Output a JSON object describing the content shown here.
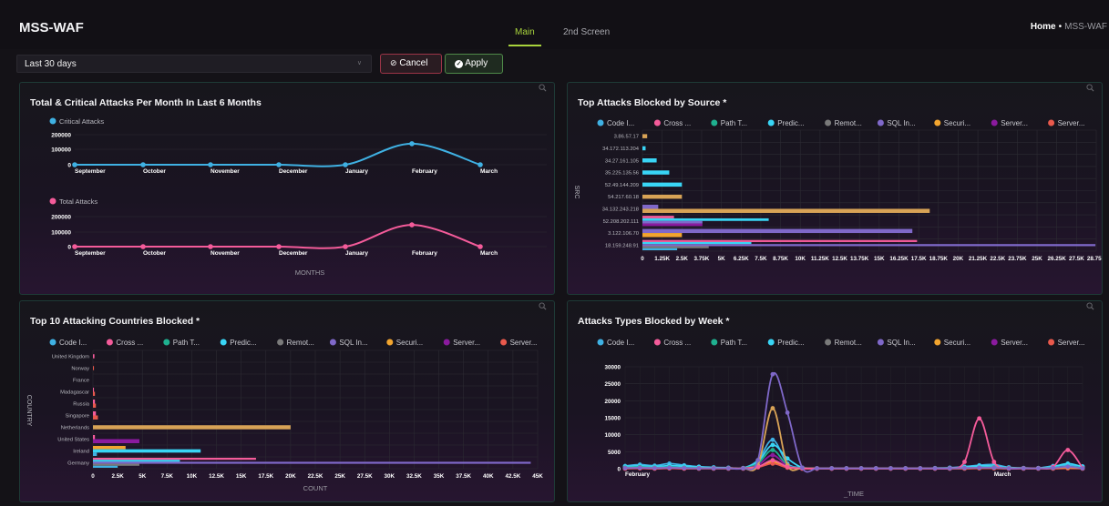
{
  "app": {
    "title": "MSS-WAF"
  },
  "tabs": [
    {
      "label": "Main",
      "active": true
    },
    {
      "label": "2nd Screen",
      "active": false
    }
  ],
  "breadcrumb": {
    "home": "Home",
    "separator": "•",
    "current": "MSS-WAF"
  },
  "filter": {
    "range_value": "Last 30 days",
    "cancel_label": "Cancel",
    "apply_label": "Apply"
  },
  "colors": {
    "accent": "#a8d33c",
    "series": {
      "Code I...": "#3fb1e3",
      "Cross ...": "#f45b9a",
      "Path T...": "#1fb08f",
      "Predic...": "#39d5f5",
      "Remot...": "#7a7a7a",
      "SQL In...": "#7f68c9",
      "Securi...": "#f2a52f",
      "Server...": "#8a1a9e",
      "Server... ": "#e9594c",
      "URL A...": "#d8a356"
    }
  },
  "chart_data": [
    {
      "type": "line",
      "title": "Total & Critical Attacks Per Month In Last 6 Months",
      "xlabel": "MONTHS",
      "categories": [
        "September",
        "October",
        "November",
        "December",
        "January",
        "February",
        "March"
      ],
      "ylim": [
        0,
        200000
      ],
      "yticks": [
        "200000",
        "100000",
        "0"
      ],
      "series": [
        {
          "name": "Critical Attacks",
          "color": "#3fb1e3",
          "values": [
            0,
            0,
            0,
            0,
            0,
            140000,
            0
          ]
        },
        {
          "name": "Total Attacks",
          "color": "#f45b9a",
          "values": [
            0,
            0,
            0,
            0,
            0,
            145000,
            0
          ]
        }
      ]
    },
    {
      "type": "bar",
      "orientation": "horizontal",
      "stacked": true,
      "title": "Top Attacks Blocked by Source *",
      "ylabel": "SRC",
      "xlim": [
        0,
        28750
      ],
      "xticks": [
        "0",
        "1.25K",
        "2.5K",
        "3.75K",
        "5K",
        "6.25K",
        "7.5K",
        "8.75K",
        "10K",
        "11.25K",
        "12.5K",
        "13.75K",
        "15K",
        "16.25K",
        "17.5K",
        "18.75K",
        "20K",
        "21.25K",
        "22.5K",
        "23.75K",
        "25K",
        "26.25K",
        "27.5K",
        "28.75K"
      ],
      "legend": [
        "Code I...",
        "Cross ...",
        "Path T...",
        "Predic...",
        "Remot...",
        "SQL In...",
        "Securi...",
        "Server...",
        "Server...",
        "URL A..."
      ],
      "categories": [
        "3.86.57.17",
        "34.172.113.204",
        "34.27.161.105",
        "35.225.135.56",
        "52.49.144.209",
        "54.217.60.18",
        "34.132.243.218",
        "52.208.202.111",
        "3.122.106.70",
        "18.159.248.91"
      ],
      "series": [
        {
          "name": "Cross ...",
          "color": "#f45b9a",
          "values": [
            0,
            0,
            0,
            0,
            0,
            0,
            0,
            2000,
            0,
            17400
          ]
        },
        {
          "name": "Predic...",
          "color": "#39d5f5",
          "values": [
            0,
            200,
            900,
            1700,
            2500,
            0,
            0,
            8000,
            0,
            6900
          ]
        },
        {
          "name": "SQL In...",
          "color": "#7f68c9",
          "values": [
            0,
            0,
            0,
            0,
            0,
            0,
            1000,
            3800,
            17100,
            28700
          ]
        },
        {
          "name": "Securi...",
          "color": "#f2a52f",
          "values": [
            0,
            0,
            0,
            0,
            0,
            0,
            0,
            0,
            2500,
            0
          ]
        },
        {
          "name": "URL A...",
          "color": "#d8a356",
          "values": [
            300,
            0,
            0,
            0,
            0,
            2500,
            18200,
            0,
            0,
            0
          ]
        },
        {
          "name": "Remot...",
          "color": "#7a7a7a",
          "values": [
            0,
            0,
            0,
            0,
            0,
            0,
            0,
            0,
            0,
            4200
          ]
        },
        {
          "name": "Server...",
          "color": "#8a1a9e",
          "values": [
            0,
            0,
            0,
            0,
            0,
            0,
            0,
            3800,
            0,
            0
          ]
        },
        {
          "name": "Code I...",
          "color": "#3fb1e3",
          "values": [
            0,
            0,
            0,
            0,
            0,
            0,
            0,
            0,
            0,
            2200
          ]
        }
      ]
    },
    {
      "type": "bar",
      "orientation": "horizontal",
      "stacked": true,
      "title": "Top 10 Attacking Countries Blocked *",
      "ylabel": "COUNTRY",
      "xlabel": "COUNT",
      "xlim": [
        0,
        45000
      ],
      "xticks": [
        "0",
        "2.5K",
        "5K",
        "7.5K",
        "10K",
        "12.5K",
        "15K",
        "17.5K",
        "20K",
        "22.5K",
        "25K",
        "27.5K",
        "30K",
        "32.5K",
        "35K",
        "37.5K",
        "40K",
        "42.5K",
        "45K"
      ],
      "legend": [
        "Code I...",
        "Cross ...",
        "Path T...",
        "Predic...",
        "Remot...",
        "SQL In...",
        "Securi...",
        "Server...",
        "Server...",
        "URL A..."
      ],
      "categories": [
        "United Kingdom",
        "Norway",
        "France",
        "Madagascar",
        "Russia",
        "Singapore",
        "Netherlands",
        "United States",
        "Ireland",
        "Germany"
      ],
      "series": [
        {
          "name": "Cross ...",
          "color": "#f45b9a",
          "values": [
            150,
            0,
            0,
            100,
            200,
            300,
            0,
            200,
            0,
            16500
          ]
        },
        {
          "name": "Server...",
          "color": "#e9594c",
          "values": [
            0,
            100,
            0,
            200,
            300,
            500,
            0,
            0,
            0,
            0
          ]
        },
        {
          "name": "URL A...",
          "color": "#d8a356",
          "values": [
            0,
            0,
            0,
            0,
            0,
            0,
            20000,
            0,
            0,
            0
          ]
        },
        {
          "name": "Server...",
          "color": "#8a1a9e",
          "values": [
            0,
            0,
            0,
            0,
            0,
            0,
            0,
            4700,
            0,
            0
          ]
        },
        {
          "name": "Securi...",
          "color": "#f2a52f",
          "values": [
            0,
            0,
            0,
            0,
            0,
            0,
            0,
            0,
            3300,
            0
          ]
        },
        {
          "name": "Predic...",
          "color": "#39d5f5",
          "values": [
            0,
            0,
            0,
            0,
            0,
            0,
            0,
            0,
            10900,
            8800
          ]
        },
        {
          "name": "SQL In...",
          "color": "#7f68c9",
          "values": [
            0,
            0,
            0,
            0,
            0,
            0,
            0,
            0,
            0,
            44300
          ]
        },
        {
          "name": "Remot...",
          "color": "#7a7a7a",
          "values": [
            0,
            0,
            0,
            0,
            0,
            0,
            0,
            0,
            0,
            4700
          ]
        },
        {
          "name": "Code I...",
          "color": "#3fb1e3",
          "values": [
            0,
            0,
            0,
            0,
            0,
            0,
            0,
            0,
            400,
            2500
          ]
        }
      ]
    },
    {
      "type": "line",
      "title": "Attacks Types Blocked by Week *",
      "xlabel": "_TIME",
      "legend": [
        "Code I...",
        "Cross ...",
        "Path T...",
        "Predic...",
        "Remot...",
        "SQL In...",
        "Securi...",
        "Server...",
        "Server...",
        "URL A..."
      ],
      "xtick_labels": [
        {
          "index": 0,
          "label": "February"
        },
        {
          "index": 25,
          "label": "March"
        }
      ],
      "ylim": [
        0,
        30000
      ],
      "yticks": [
        "30000",
        "25000",
        "20000",
        "15000",
        "10000",
        "5000",
        "0"
      ],
      "x_count": 32,
      "series": [
        {
          "name": "Code I...",
          "color": "#3fb1e3",
          "values": [
            800,
            1200,
            900,
            1500,
            1000,
            600,
            400,
            300,
            200,
            2500,
            8500,
            1500,
            300,
            100,
            100,
            100,
            100,
            100,
            100,
            100,
            100,
            200,
            300,
            600,
            1000,
            1200,
            400,
            200,
            200,
            800,
            1000,
            700
          ]
        },
        {
          "name": "Predic...",
          "color": "#39d5f5",
          "values": [
            600,
            800,
            600,
            900,
            700,
            500,
            300,
            200,
            200,
            2000,
            7000,
            3000,
            300,
            100,
            100,
            100,
            100,
            100,
            100,
            100,
            100,
            100,
            200,
            400,
            800,
            700,
            300,
            200,
            200,
            600,
            1500,
            600
          ]
        },
        {
          "name": "Path T...",
          "color": "#1fb08f",
          "values": [
            300,
            500,
            300,
            400,
            300,
            200,
            150,
            100,
            100,
            1500,
            5500,
            1000,
            200,
            100,
            100,
            100,
            100,
            100,
            100,
            100,
            100,
            100,
            100,
            200,
            300,
            400,
            200,
            100,
            100,
            300,
            600,
            200
          ]
        },
        {
          "name": "Server...",
          "color": "#8a1a9e",
          "values": [
            100,
            200,
            100,
            200,
            100,
            100,
            100,
            100,
            100,
            1000,
            4000,
            800,
            100,
            50,
            50,
            50,
            50,
            50,
            50,
            50,
            50,
            50,
            50,
            100,
            200,
            200,
            100,
            100,
            100,
            100,
            300,
            100
          ]
        },
        {
          "name": "Securi...",
          "color": "#f2a52f",
          "values": [
            100,
            200,
            100,
            200,
            100,
            100,
            100,
            100,
            100,
            600,
            2000,
            500,
            100,
            50,
            50,
            50,
            50,
            50,
            50,
            50,
            50,
            50,
            50,
            100,
            200,
            200,
            100,
            100,
            100,
            100,
            300,
            100
          ]
        },
        {
          "name": "Server...",
          "color": "#e9594c",
          "values": [
            0,
            100,
            0,
            100,
            0,
            0,
            0,
            0,
            0,
            400,
            1500,
            300,
            0,
            0,
            0,
            0,
            0,
            0,
            0,
            0,
            0,
            0,
            0,
            0,
            100,
            100,
            0,
            0,
            0,
            0,
            100,
            0
          ]
        },
        {
          "name": "URL A...",
          "color": "#d8a356",
          "values": [
            200,
            300,
            200,
            300,
            200,
            100,
            100,
            100,
            100,
            1000,
            17800,
            1000,
            200,
            100,
            100,
            100,
            100,
            100,
            100,
            100,
            100,
            100,
            100,
            200,
            300,
            300,
            100,
            100,
            100,
            200,
            400,
            100
          ]
        },
        {
          "name": "Cross ...",
          "color": "#f45b9a",
          "values": [
            100,
            200,
            100,
            200,
            100,
            100,
            100,
            100,
            100,
            500,
            2500,
            500,
            100,
            50,
            50,
            50,
            50,
            50,
            50,
            50,
            50,
            50,
            100,
            2000,
            14800,
            2000,
            100,
            100,
            100,
            500,
            5500,
            200
          ]
        },
        {
          "name": "SQL In...",
          "color": "#7f68c9",
          "values": [
            200,
            300,
            200,
            300,
            200,
            100,
            100,
            100,
            100,
            2500,
            27800,
            16500,
            300,
            100,
            100,
            100,
            100,
            100,
            100,
            100,
            100,
            100,
            100,
            200,
            300,
            300,
            100,
            100,
            100,
            200,
            600,
            100
          ]
        }
      ]
    }
  ]
}
